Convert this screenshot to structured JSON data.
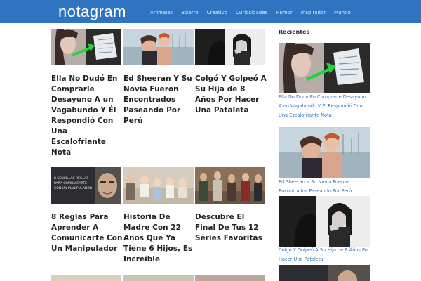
{
  "site": {
    "logo": "notagram"
  },
  "nav": [
    "Animales",
    "Bizarro",
    "Creativo",
    "Curiosidades",
    "Humor",
    "Inspirador",
    "Mundo"
  ],
  "articles": [
    {
      "title": "Ella No Dudó En Comprarle Desayuno A un Vagabundo Y Él Respondió Con Una Escalofriante Nota",
      "thumb_icon": "woman-note-photo"
    },
    {
      "title": "Ed Sheeran Y Su Novia Fueron Encontrados Paseando Por Perú",
      "thumb_icon": "couple-beach-photo"
    },
    {
      "title": "Colgó Y Golpeó A Su Hija de 8 Años Por Hacer Una Pataleta",
      "thumb_icon": "crying-girl-photo"
    },
    {
      "title": "8 Reglas Para Aprender A Comunicarte Con Un Manipulador",
      "thumb_icon": "manipulator-photo",
      "thumb_text": "8 SENCILLAS REGLAS PARA COMUNICARTE CON UN MANIPULADOR"
    },
    {
      "title": "Historia De Madre Con 22 Años Que Ya Tiene 6 Hijos, Es Increíble",
      "thumb_icon": "babies-photo"
    },
    {
      "title": "Descubre El Final De Tus 12 Series Favoritas",
      "thumb_icon": "tv-cast-photo"
    }
  ],
  "sidebar": {
    "heading": "Recientes",
    "items": [
      {
        "caption": "Ella No Dudó En Comprarle Desayuno A un Vagabundo Y Él Respondió Con Una Escalofriante Nota"
      },
      {
        "caption": "Ed Sheeran Y Su Novia Fueron Encontrados Paseando Por Perú"
      },
      {
        "caption": "Colgó Y Golpeó A Su Hija de 8 Años Por Hacer Una Pataleta"
      }
    ]
  },
  "colors": {
    "header": "#2e74c0",
    "link": "#2e74c0",
    "title": "#222222"
  }
}
